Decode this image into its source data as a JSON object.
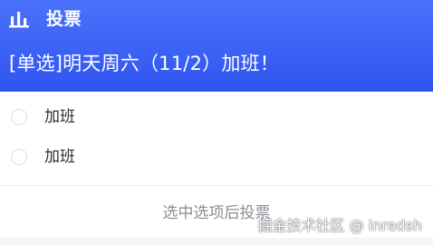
{
  "poll": {
    "header_label": "投票",
    "header_icon": "bar-chart-icon",
    "question": "[单选]明天周六（11/2）加班！",
    "options": [
      {
        "label": "加班",
        "selected": false
      },
      {
        "label": "加班",
        "selected": false
      }
    ],
    "submit_label": "选中选项后投票"
  },
  "watermark": "掘金技术社区 @ inredsh",
  "colors": {
    "header_gradient_top": "#4a72fb",
    "header_gradient_bottom": "#2f55f0",
    "text_primary": "#2b2d31",
    "text_muted": "#8a8e96"
  }
}
